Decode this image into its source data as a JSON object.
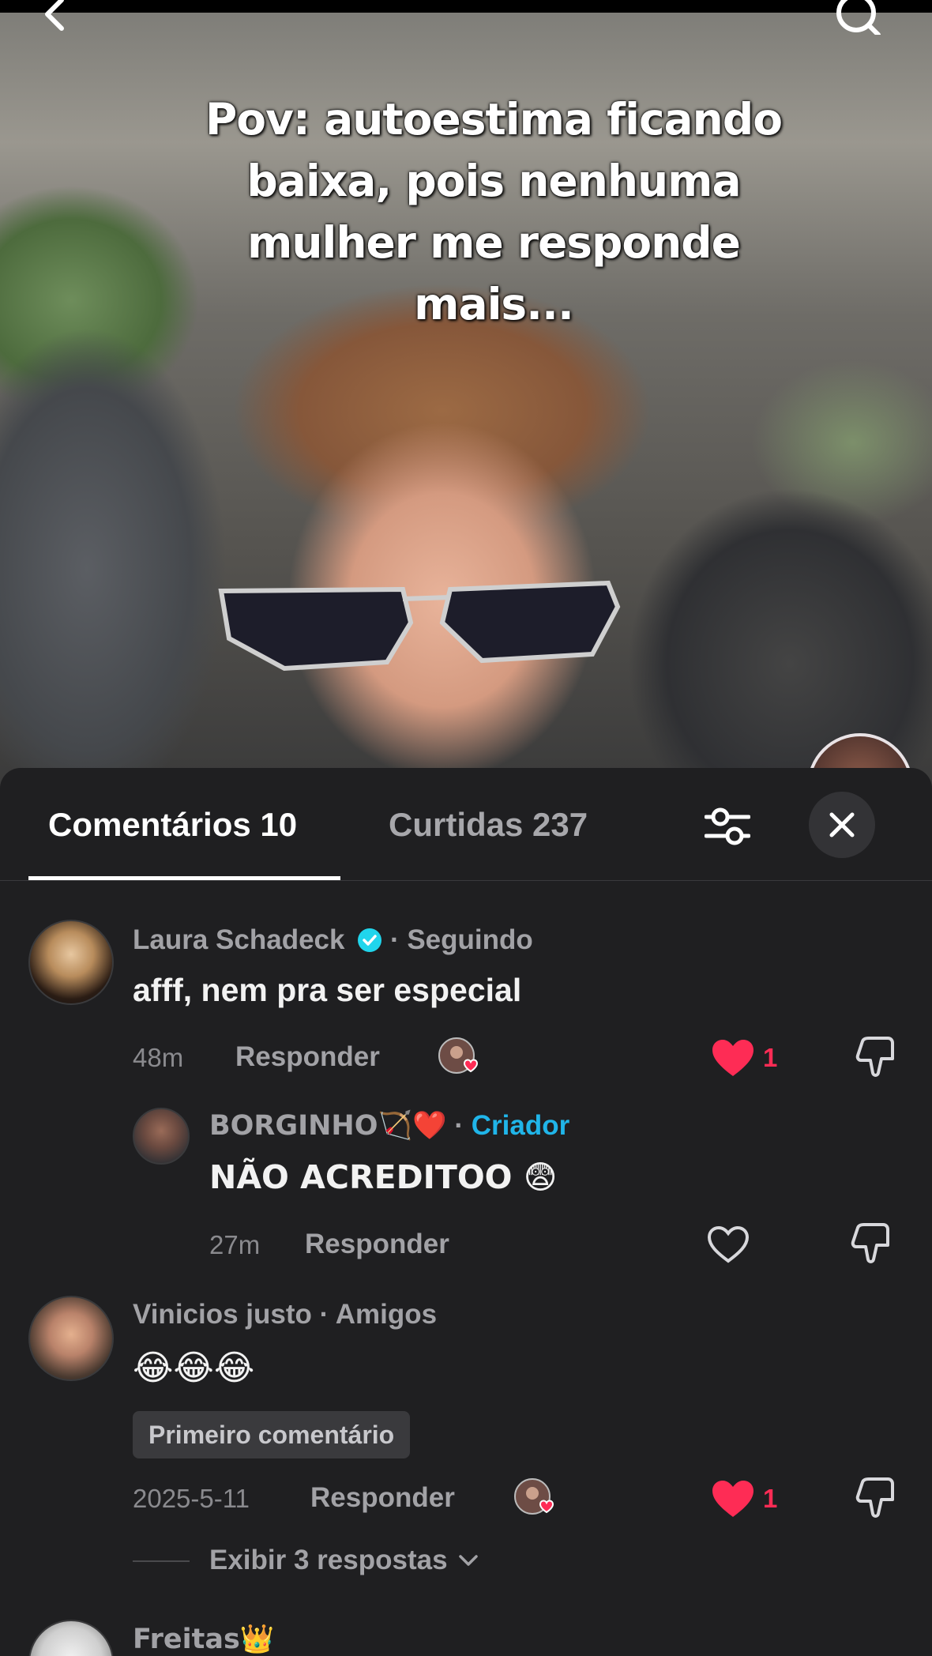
{
  "video": {
    "overlay_lines": [
      "Pov: autoestima ficando",
      "baixa, pois nenhuma",
      "mulher me responde",
      "mais..."
    ]
  },
  "tabs": {
    "comments_label": "Comentários 10",
    "likes_label": "Curtidas 237"
  },
  "comments": [
    {
      "username": "Laura Schadeck",
      "verified": true,
      "relation": "· Seguindo",
      "text": "afff, nem pra ser especial",
      "time": "48m",
      "reply_label": "Responder",
      "creator_liked": true,
      "likes": "1",
      "liked": true
    },
    {
      "username": "BORGINHO🏹❤️",
      "relation_sep": "·",
      "relation": "Criador",
      "text": "NÃO ACREDITOO 😨",
      "time": "27m",
      "reply_label": "Responder",
      "liked": false
    },
    {
      "username": "Vinicios justo",
      "relation": "· Amigos",
      "text": "😂😂😂",
      "badge": "Primeiro comentário",
      "time": "2025-5-11",
      "reply_label": "Responder",
      "creator_liked": true,
      "likes": "1",
      "liked": true,
      "view_replies": "Exibir 3 respostas"
    },
    {
      "username": "Freitas👑"
    }
  ],
  "colors": {
    "panel_bg": "#1f1f21",
    "like_red": "#fe2c55",
    "creator_blue": "#20b5e9",
    "verified_blue": "#20d5ec"
  },
  "icons": [
    "back-chevron-icon",
    "search-icon",
    "filter-sliders-icon",
    "close-icon",
    "heart-icon",
    "dislike-icon",
    "verified-icon",
    "chevron-down-icon"
  ]
}
